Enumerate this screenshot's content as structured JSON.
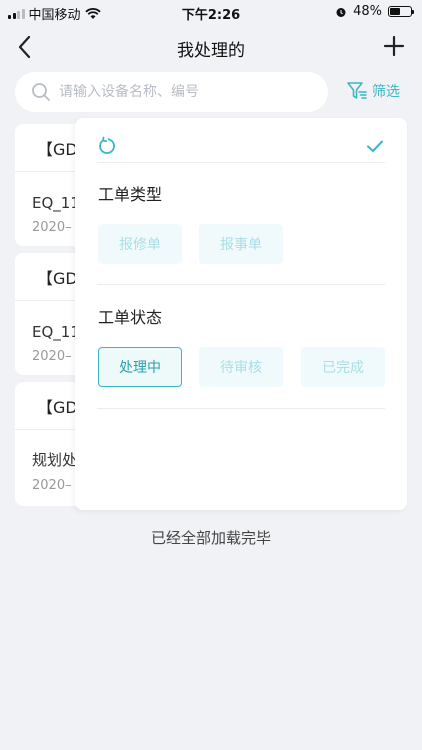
{
  "status_bar": {
    "carrier": "中国移动",
    "time": "下午2:26",
    "battery": "48%",
    "battery_level": 0.48
  },
  "nav": {
    "title": "我处理的"
  },
  "search": {
    "placeholder": "请输入设备名称、编号",
    "filter_label": "筛选"
  },
  "cards": [
    {
      "head": "【GD_",
      "line1": "EQ_11",
      "line2": "2020–"
    },
    {
      "head": "【GD_",
      "line1": "EQ_11",
      "line2": "2020–"
    },
    {
      "head": "【GD_",
      "line1": "规划处",
      "line2": "2020–"
    }
  ],
  "footer": "已经全部加载完毕",
  "filter_panel": {
    "type_section": {
      "title": "工单类型",
      "options": [
        "报修单",
        "报事单"
      ]
    },
    "status_section": {
      "title": "工单状态",
      "options": [
        "处理中",
        "待审核",
        "已完成"
      ],
      "selected": "处理中"
    }
  },
  "colors": {
    "accent": "#3bb7c4",
    "chip_bg": "#f0fafc",
    "chip_text": "#a9dfe5",
    "background": "#f1f2f6"
  },
  "icons": [
    "back-icon",
    "add-icon",
    "search-icon",
    "filter-icon",
    "reset-icon",
    "check-icon",
    "wifi-icon",
    "alarm-icon",
    "battery-icon"
  ]
}
